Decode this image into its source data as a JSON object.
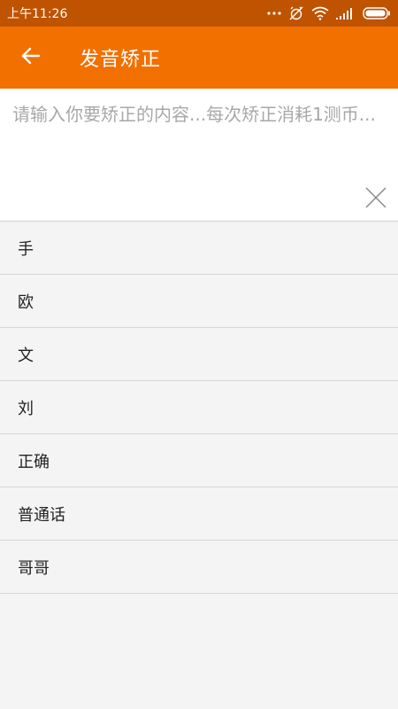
{
  "status_bar": {
    "time": "上午11:26",
    "icons": [
      "more-dots-icon",
      "alarm-off-icon",
      "wifi-icon",
      "signal-icon",
      "battery-icon"
    ]
  },
  "app_bar": {
    "back_icon": "arrow-left-icon",
    "title": "发音矫正",
    "background": "#f27000"
  },
  "input": {
    "value": "",
    "placeholder": "请输入你要矫正的内容...每次矫正消耗1测币...",
    "clear_icon": "close-icon"
  },
  "history": [
    {
      "text": "手"
    },
    {
      "text": "欧"
    },
    {
      "text": "文"
    },
    {
      "text": "刘"
    },
    {
      "text": "正确"
    },
    {
      "text": "普通话"
    },
    {
      "text": "哥哥"
    }
  ],
  "colors": {
    "accent": "#f27000",
    "status_bar": "#bf5300"
  }
}
